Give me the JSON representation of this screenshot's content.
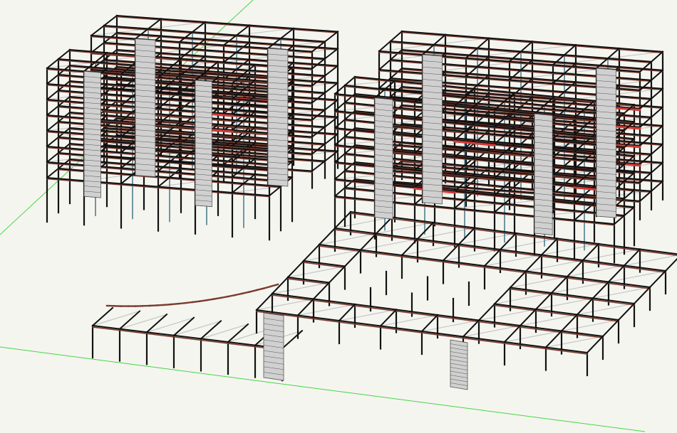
{
  "scene": {
    "kind": "3D structural frame model, isometric wireframe view",
    "colors": {
      "background": "#f5f5f0",
      "column": "#111111",
      "column_highlight": "#4f7f8f",
      "beam_top": "#111111",
      "beam_side": "#7a3b2e",
      "slab_line": "#c8c8c8",
      "red_beam": "#d23a35",
      "core_fill": "#d0d0d0",
      "core_line": "#555555",
      "axis_line": "#44d644"
    },
    "structures": [
      {
        "name": "tower-left-rear",
        "floors": 8
      },
      {
        "name": "tower-left-front",
        "floors": 8
      },
      {
        "name": "tower-right-rear",
        "floors": 8
      },
      {
        "name": "tower-right-front",
        "floors": 7
      },
      {
        "name": "podium-courtyard",
        "floors": 1
      },
      {
        "name": "curved-canopy",
        "floors": 1
      }
    ]
  }
}
